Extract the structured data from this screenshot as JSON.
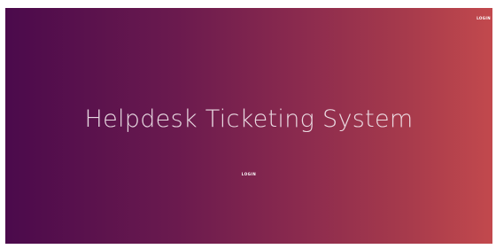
{
  "nav": {
    "login_label": "LOGIN"
  },
  "hero": {
    "title": "Helpdesk Ticketing System",
    "login_label": "LOGIN"
  },
  "colors": {
    "gradient_start": "#4b0a4c",
    "gradient_end": "#c2494d",
    "text": "#ffffff"
  }
}
